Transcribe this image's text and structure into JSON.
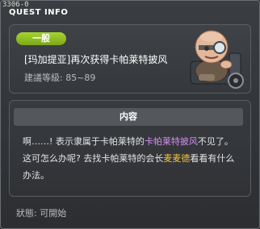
{
  "window": {
    "quest_id": "3306-0",
    "title": "QUEST INFO"
  },
  "quest": {
    "category_badge": "一般",
    "name": "[玛加提亚]再次获得卡帕莱特披风",
    "level_range": "建議等級: 85~89",
    "npc_icon": "bald-npc-in-wheelchair-portrait"
  },
  "content": {
    "header": "内容",
    "text_part1": "啊……! 表示隶属于卡帕莱特的",
    "highlight_item": "卡帕莱特披风",
    "text_part2": "不见了。这可怎么办呢? 去找卡帕莱特的会长",
    "highlight_npc": "麦麦德",
    "text_part3": "看看有什么办法。"
  },
  "status": {
    "text": "狀態: 可開始"
  },
  "colors": {
    "badge_green": "#8fc023",
    "highlight_purple": "#d58cf2",
    "highlight_gold": "#f6c53a"
  }
}
